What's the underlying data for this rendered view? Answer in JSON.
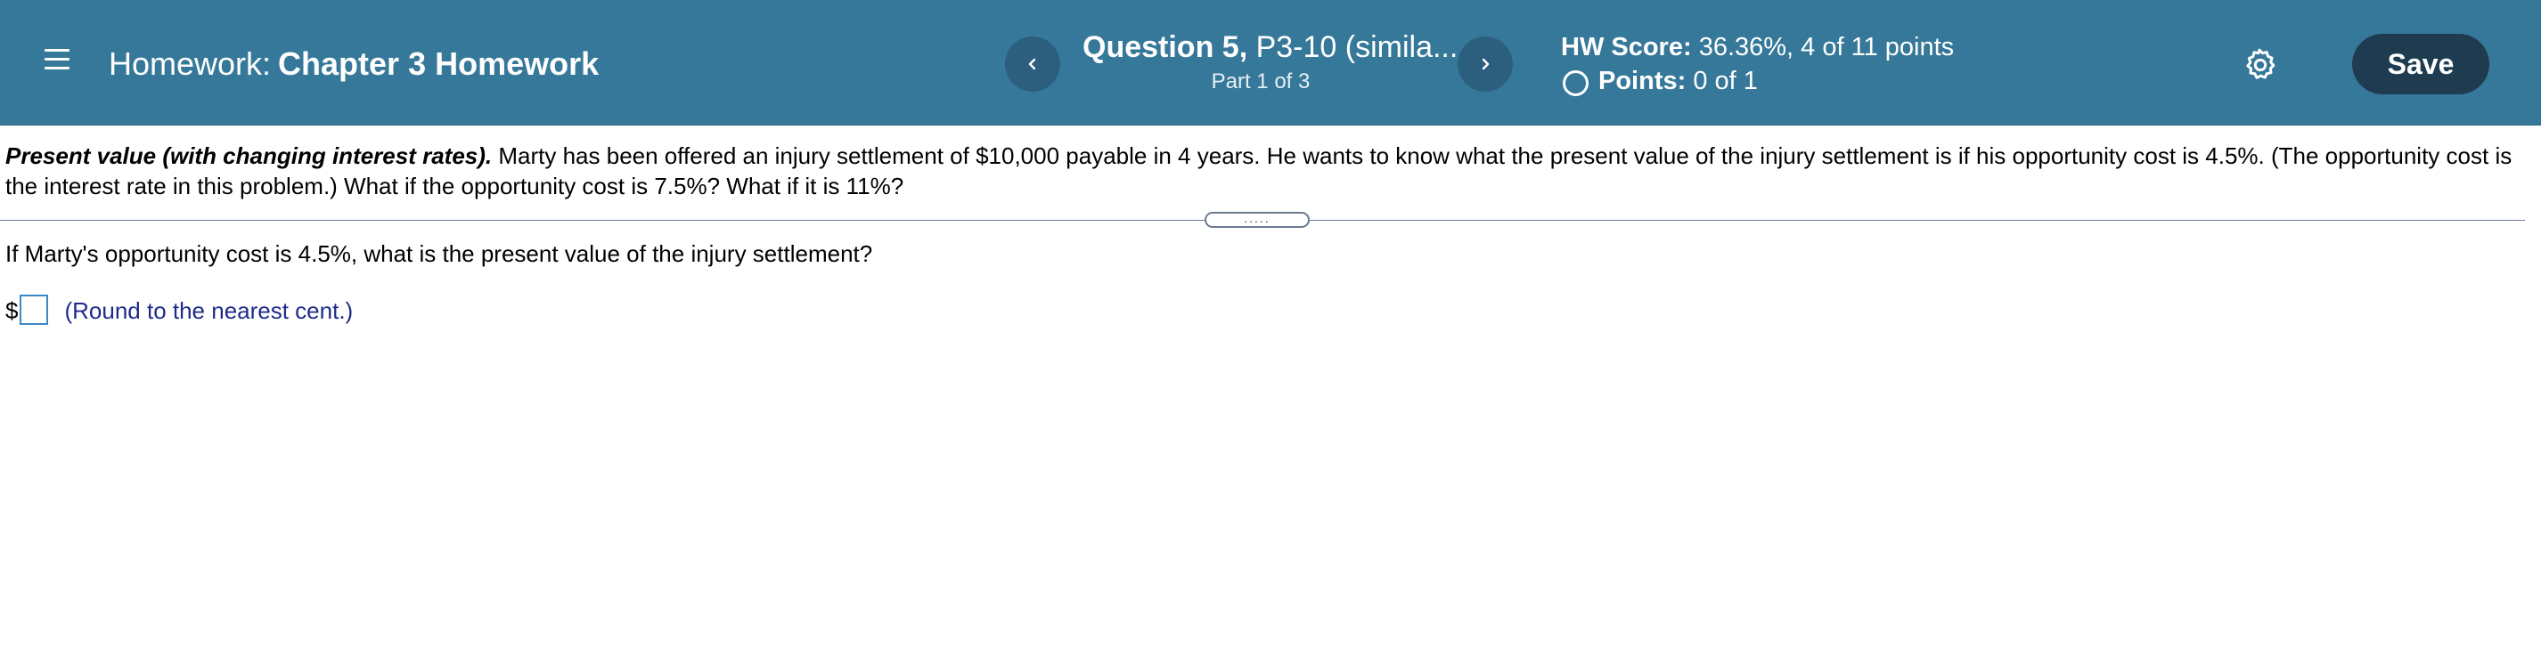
{
  "header": {
    "homework_prefix": "Homework:",
    "homework_name": "Chapter 3 Homework",
    "question_number": "Question 5,",
    "question_id": "P3-10 (simila...",
    "question_part": "Part 1 of 3",
    "hw_score_label": "HW Score:",
    "hw_score_value": "36.36%, 4 of 11 points",
    "points_label": "Points:",
    "points_value": "0 of 1",
    "save_label": "Save",
    "menu_icon": "hamburger-menu-icon",
    "prev_icon": "chevron-left-icon",
    "next_icon": "chevron-right-icon",
    "settings_icon": "gear-icon",
    "colors": {
      "header_bg": "#367899",
      "nav_button_bg": "#2c5f7e",
      "save_button_bg": "#1f3b50",
      "hint_text": "#1e2b8a",
      "input_border": "#3b88c7"
    }
  },
  "problem": {
    "title": "Present value (with changing interest rates).",
    "body": "Marty has been offered an injury settlement of $10,000 payable in 4 years.  He wants to know what the present value of the injury settlement is if his opportunity cost is 4.5%.  (The opportunity cost is the interest rate in this problem.)  What if the opportunity cost is 7.5%?  What if it is 11%?"
  },
  "divider": {
    "handle_dots": "....."
  },
  "part": {
    "question": "If Marty's opportunity cost is 4.5%, what is the present value of the injury settlement?",
    "currency_symbol": "$",
    "answer_value": "",
    "hint": "(Round to the nearest cent.)"
  }
}
